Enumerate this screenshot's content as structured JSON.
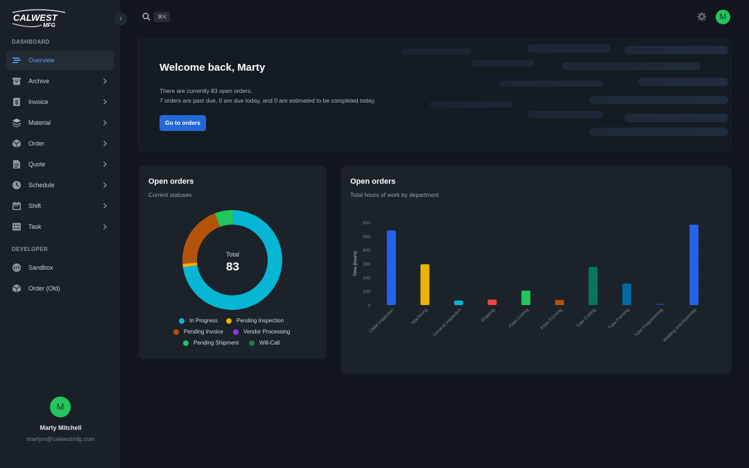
{
  "brand": {
    "logo_text_top": "CALWEST",
    "logo_text_bottom": "MFG"
  },
  "sidebar": {
    "section_dashboard": "DASHBOARD",
    "section_developer": "DEVELOPER",
    "collapse_glyph": "‹",
    "items": [
      {
        "label": "Overview",
        "icon": "overview-icon"
      },
      {
        "label": "Archive",
        "icon": "archive-icon"
      },
      {
        "label": "Invoice",
        "icon": "invoice-icon"
      },
      {
        "label": "Material",
        "icon": "material-icon"
      },
      {
        "label": "Order",
        "icon": "order-icon"
      },
      {
        "label": "Quote",
        "icon": "quote-icon"
      },
      {
        "label": "Schedule",
        "icon": "schedule-icon"
      },
      {
        "label": "Shift",
        "icon": "shift-icon"
      },
      {
        "label": "Task",
        "icon": "task-icon"
      }
    ],
    "dev_items": [
      {
        "label": "Sandbox",
        "icon": "sandbox-icon"
      },
      {
        "label": "Order (Old)",
        "icon": "order-old-icon"
      }
    ],
    "user": {
      "initial": "M",
      "name": "Marty Mitchell",
      "email": "martym@calwestmfg.com"
    }
  },
  "topbar": {
    "shortcut": "⌘K",
    "avatar_initial": "M"
  },
  "welcome": {
    "title": "Welcome back, Marty",
    "line1": "There are currently 83 open orders.",
    "line2": "7 orders are past due, 0 are due today, and 0 are estimated to be completed today.",
    "button": "Go to orders"
  },
  "status_card": {
    "title": "Open orders",
    "subtitle": "Current statuses",
    "total_label": "Total",
    "total_value": "83",
    "legend": [
      {
        "label": "In Progress",
        "color": "#06b6d4"
      },
      {
        "label": "Pending Inspection",
        "color": "#eab308"
      },
      {
        "label": "Pending Invoice",
        "color": "#b45309"
      },
      {
        "label": "Vendor Processing",
        "color": "#9333ea"
      },
      {
        "label": "Pending Shipment",
        "color": "#22c55e"
      },
      {
        "label": "Will-Call",
        "color": "#15803d"
      }
    ]
  },
  "hours_card": {
    "title": "Open orders",
    "subtitle": "Total hours of work by department"
  },
  "chart_data": [
    {
      "type": "pie",
      "categories": [
        "In Progress",
        "Pending Inspection",
        "Pending Invoice",
        "Vendor Processing",
        "Pending Shipment",
        "Will-Call"
      ],
      "values": [
        60,
        1,
        17,
        0,
        5,
        0
      ],
      "colors": [
        "#06b6d4",
        "#eab308",
        "#b45309",
        "#9333ea",
        "#22c55e",
        "#15803d"
      ],
      "title": "Open orders"
    },
    {
      "type": "bar",
      "title": "Open orders",
      "ylabel": "Time (hours)",
      "xlabel": "",
      "ylim": [
        0,
        600
      ],
      "yticks": [
        0,
        100,
        200,
        300,
        400,
        500,
        600
      ],
      "grid": true,
      "categories": [
        "CMM Inspection",
        "Machining",
        "General Inspection",
        "Shipping",
        "Plate Cutting",
        "Plate Forming",
        "Tube Cutting",
        "Tube Forming",
        "Tube Programming",
        "Welding and Assembly"
      ],
      "values": [
        543,
        297,
        33,
        40,
        105,
        38,
        278,
        157,
        10,
        585
      ],
      "colors": [
        "#2563eb",
        "#eab308",
        "#06b6d4",
        "#ef4444",
        "#22c55e",
        "#b45309",
        "#047857",
        "#0369a1",
        "#1e3a8a",
        "#2563eb"
      ]
    }
  ]
}
